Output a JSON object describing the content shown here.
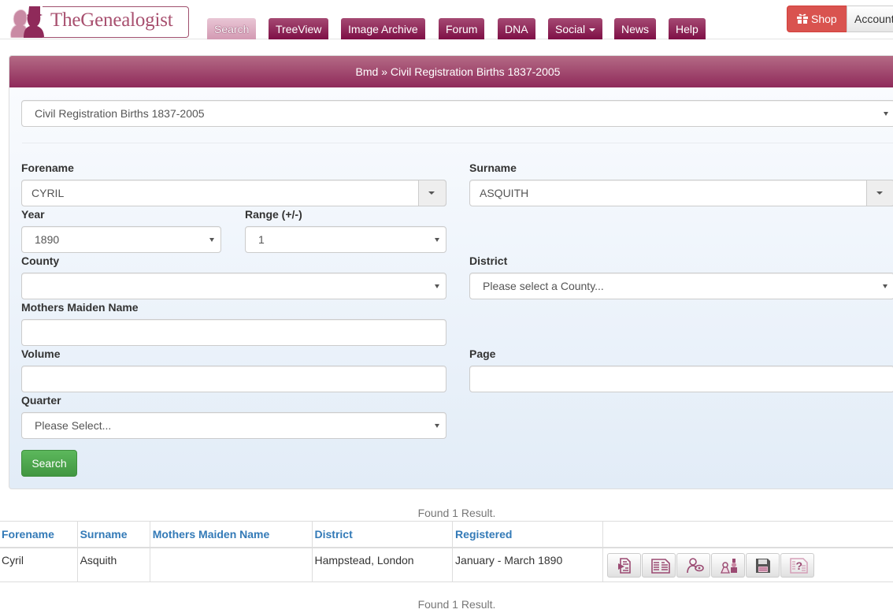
{
  "header": {
    "logo_text": "TheGenealogist",
    "nav": [
      {
        "label": "Search",
        "active": true
      },
      {
        "label": "TreeView"
      },
      {
        "label": "Image Archive"
      },
      {
        "label": "Forum"
      },
      {
        "label": "DNA"
      },
      {
        "label": "Social",
        "has_dropdown": true
      },
      {
        "label": "News"
      },
      {
        "label": "Help"
      }
    ],
    "shop_label": "Shop",
    "shop_icon": "gift-icon",
    "account_label": "Account"
  },
  "panel": {
    "breadcrumb": "Bmd » Civil Registration Births 1837-2005",
    "dataset_select": "Civil Registration Births 1837-2005",
    "fields": {
      "forename": {
        "label": "Forename",
        "value": "CYRIL"
      },
      "surname": {
        "label": "Surname",
        "value": "ASQUITH"
      },
      "year": {
        "label": "Year",
        "value": "1890"
      },
      "range": {
        "label": "Range (+/-)",
        "value": "1"
      },
      "county": {
        "label": "County",
        "value": ""
      },
      "district": {
        "label": "District",
        "value": "Please select a County..."
      },
      "mothers_maiden_name": {
        "label": "Mothers Maiden Name",
        "value": ""
      },
      "volume": {
        "label": "Volume",
        "value": ""
      },
      "page": {
        "label": "Page",
        "value": ""
      },
      "quarter": {
        "label": "Quarter",
        "value": "Please Select..."
      }
    },
    "search_button": "Search"
  },
  "results": {
    "found_text_top": "Found 1 Result.",
    "found_text_bottom": "Found 1 Result.",
    "columns": [
      "Forename",
      "Surname",
      "Mothers Maiden Name",
      "District",
      "Registered",
      ""
    ],
    "rows": [
      {
        "forename": "Cyril",
        "surname": "Asquith",
        "mothers_maiden_name": "",
        "district": "Hampstead, London",
        "registered": "January - March 1890",
        "actions": [
          "transcript-icon",
          "index-page-icon",
          "link-record-icon",
          "family-icon",
          "save-icon",
          "help-icon"
        ]
      }
    ]
  },
  "colors": {
    "brand": "#8f2a5a",
    "nav_tab": "#7e0f46",
    "shop": "#d9534f",
    "search_button": "#5cb85c",
    "table_header_link": "#337ab7"
  }
}
